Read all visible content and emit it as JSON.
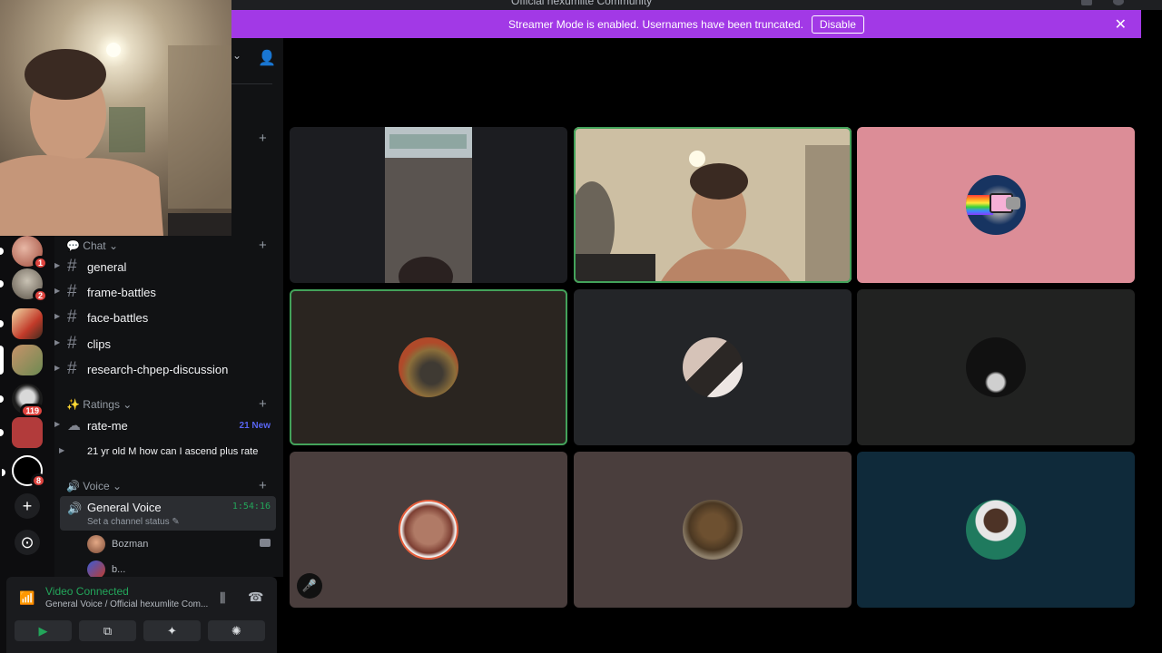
{
  "window": {
    "title": "Official hexumlite Community"
  },
  "banner": {
    "message": "Streamer Mode is enabled. Usernames have been truncated.",
    "disable_label": "Disable",
    "close_glyph": "✕",
    "color": "#a239e6"
  },
  "rail": {
    "badges": [
      "1",
      "2",
      "119",
      "8"
    ],
    "add_glyph": "+",
    "explore_glyph": "⊙"
  },
  "sidebar": {
    "categories": {
      "chat": "💬 Chat ⌄",
      "ratings": "✨ Ratings ⌄",
      "voice": "🔊 Voice ⌄"
    },
    "chat_channels": [
      "general",
      "frame-battles",
      "face-battles",
      "clips",
      "research-chpep-discussion"
    ],
    "ratings_channel": {
      "name": "rate-me",
      "new": "21 New"
    },
    "thread": "21 yr old M how can I ascend plus rate",
    "voice_channel": {
      "name": "General Voice",
      "timer": "1:54:16",
      "status": "Set a channel status ✎"
    },
    "voice_users": [
      "Bozman",
      "b..."
    ]
  },
  "voice_panel": {
    "title": "Video Connected",
    "subtitle": "General Voice / Official hexumlite Com...",
    "accent": "#23a55a"
  },
  "grid": {
    "tiles": [
      {
        "kind": "video"
      },
      {
        "kind": "video"
      },
      {
        "kind": "avatar"
      },
      {
        "kind": "avatar"
      },
      {
        "kind": "avatar"
      },
      {
        "kind": "avatar"
      },
      {
        "kind": "avatar"
      },
      {
        "kind": "avatar"
      },
      {
        "kind": "avatar"
      }
    ],
    "active_speaker_color": "#43a25a"
  }
}
